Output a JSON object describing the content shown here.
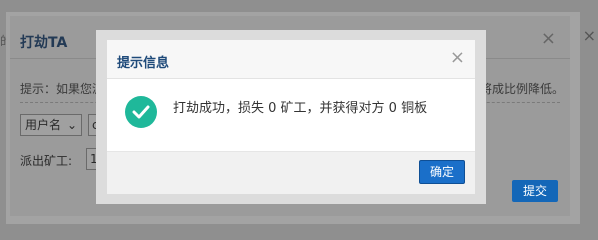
{
  "background_dialog": {
    "title": "打劫TA",
    "close_glyph": "×",
    "tip": "提示：如果您派",
    "tip_tail": "将成比例降低。",
    "select_value": "用户名",
    "select_caret": "⌄",
    "user_input_value": "cjc",
    "send_label": "派出矿工:",
    "send_value": "10",
    "submit_label": "提交"
  },
  "edge_fragments": {
    "left_fragment": "的",
    "right_fragment": "×"
  },
  "modal": {
    "title": "提示信息",
    "close_glyph": "×",
    "icon": "success-check-icon",
    "message": "打劫成功，损失 0 矿工，并获得对方 0 铜板",
    "confirm_label": "确定",
    "accent_color": "#1fb89a",
    "button_color": "#1a6fc9"
  }
}
